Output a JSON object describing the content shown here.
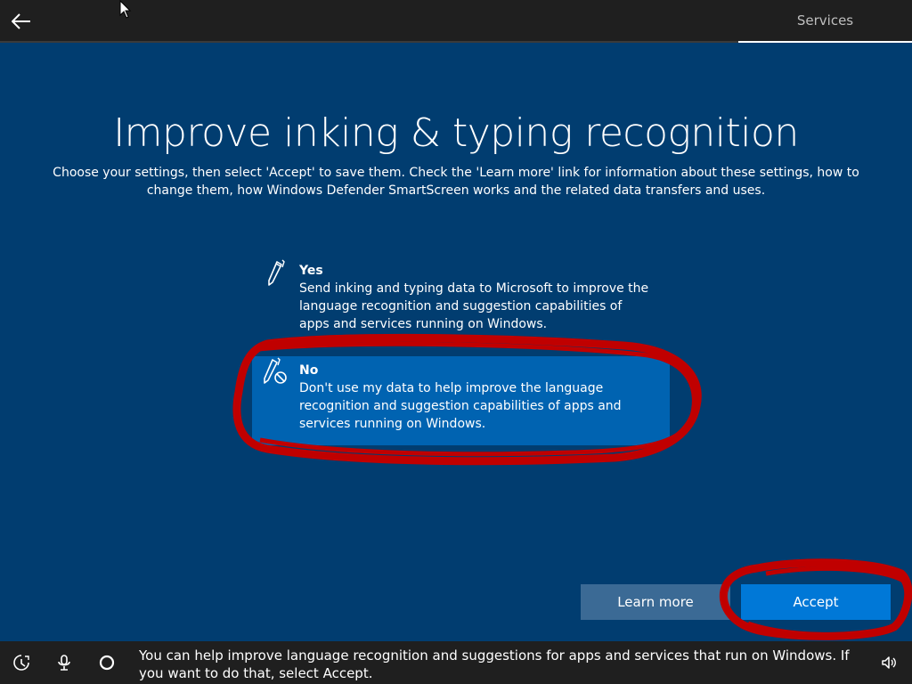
{
  "header": {
    "step_label": "Services"
  },
  "main": {
    "title": "Improve inking & typing recognition",
    "subtitle": "Choose your settings, then select 'Accept' to save them. Check the 'Learn more' link for information about these settings, how to change them, how Windows Defender SmartScreen works and the related data transfers and uses.",
    "options": [
      {
        "title": "Yes",
        "description": "Send inking and typing data to Microsoft to improve the language recognition and suggestion capabilities of apps and services running on Windows."
      },
      {
        "title": "No",
        "description": "Don't use my data to help improve the language recognition and suggestion capabilities of apps and services running on Windows."
      }
    ],
    "selected_option": "No"
  },
  "buttons": {
    "learn_more": "Learn more",
    "accept": "Accept"
  },
  "footer": {
    "narration": "You can help improve language recognition and suggestions for apps and services that run on Windows. If you want to do that, select Accept.",
    "icons": [
      "ease-of-access-icon",
      "microphone-icon",
      "cortana-icon",
      "volume-icon"
    ]
  },
  "colors": {
    "background": "#013d70",
    "bar": "#1f1f1f",
    "selected": "#0063b1",
    "accept": "#0078d7",
    "learn_more": "#3b6a95",
    "annotation": "#c00000"
  }
}
